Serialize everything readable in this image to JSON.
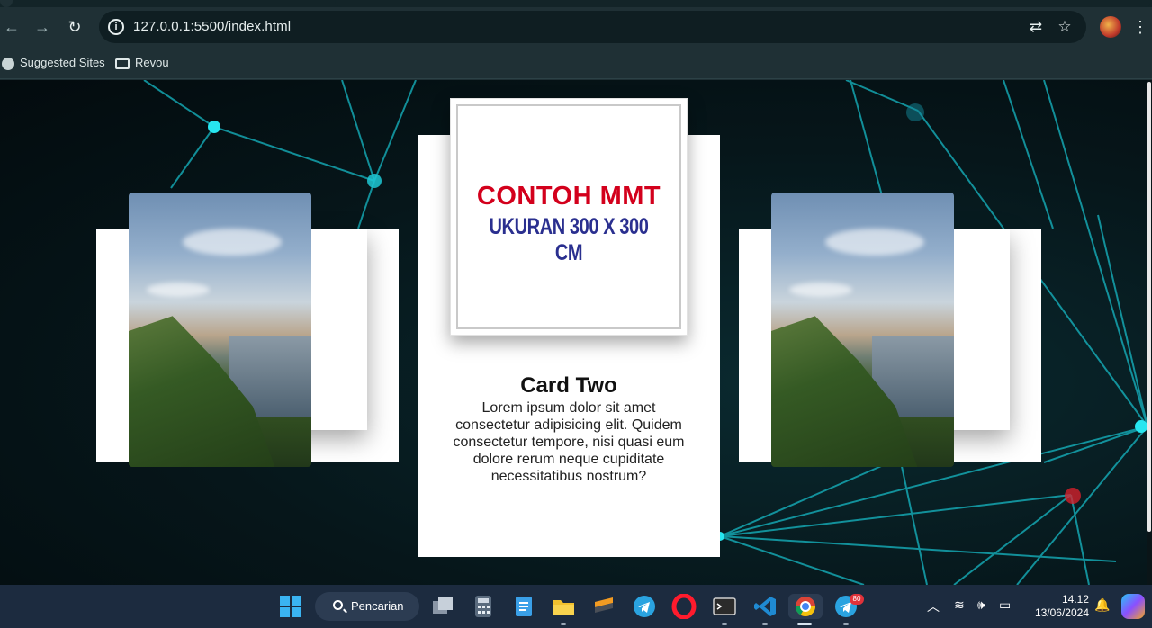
{
  "browser": {
    "url": "127.0.0.1:5500/index.html",
    "bookmarks": [
      {
        "label": "Suggested Sites",
        "icon": "globe-icon"
      },
      {
        "label": "Revou",
        "icon": "folder-icon"
      }
    ]
  },
  "page": {
    "banner": {
      "line1": "CONTOH MMT",
      "line2": "UKURAN 300 X 300 CM",
      "line1_color": "#d3001c",
      "line2_color": "#2a2f8f"
    },
    "card_two": {
      "title": "Card Two",
      "text": "Lorem ipsum dolor sit amet consectetur adipisicing elit. Quidem consectetur tempore, nisi quasi eum dolore rerum neque cupiditate necessitatibus nostrum?"
    }
  },
  "taskbar": {
    "search_label": "Pencarian",
    "telegram_badge": "80",
    "time": "14.12",
    "date": "13/06/2024",
    "icons": [
      "windows-start-icon",
      "task-view-icon",
      "calculator-icon",
      "notepad-icon",
      "file-explorer-icon",
      "sublime-icon",
      "telegram-icon",
      "opera-icon",
      "terminal-icon",
      "vscode-icon",
      "chrome-icon",
      "telegram-desktop-icon"
    ]
  }
}
